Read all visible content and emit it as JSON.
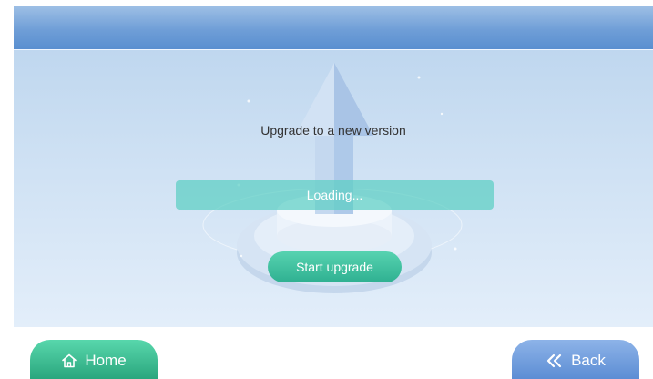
{
  "upgrade": {
    "title": "Upgrade to a new version",
    "progress_text": "Loading...",
    "start_label": "Start upgrade"
  },
  "footer": {
    "home_label": "Home",
    "home_icon": "home-icon",
    "back_label": "Back",
    "back_icon": "double-chevron-left-icon"
  },
  "colors": {
    "header": "#6f9ed7",
    "background": "#cde0f3",
    "progress": "#5ccec4",
    "start_button": "#2fb091",
    "home_button": "#2aa67d",
    "back_button": "#5c8dd4"
  }
}
